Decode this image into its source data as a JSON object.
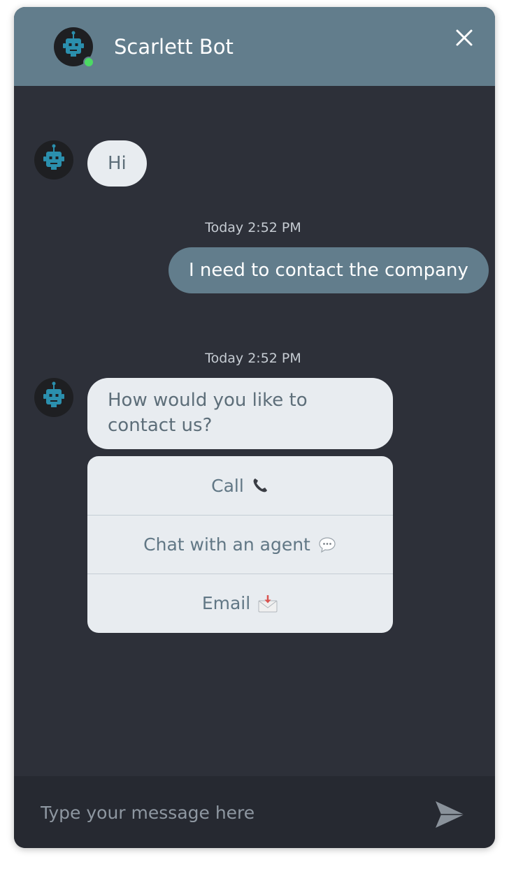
{
  "header": {
    "bot_name": "Scarlett Bot",
    "status": "online",
    "status_color": "#4cd964",
    "close_icon": "close-icon"
  },
  "messages": [
    {
      "from": "bot",
      "text": "Hi"
    },
    {
      "timestamp": "Today 2:52 PM",
      "from": "user",
      "text": "I need to contact the company"
    },
    {
      "timestamp": "Today 2:52 PM",
      "from": "bot",
      "text": "How would you like to contact us?"
    }
  ],
  "options": [
    {
      "label": "Call",
      "icon": "telephone-icon"
    },
    {
      "label": "Chat with an agent",
      "icon": "speech-bubble-icon"
    },
    {
      "label": "Email",
      "icon": "envelope-icon"
    }
  ],
  "composer": {
    "placeholder": "Type your message here",
    "value": "",
    "send_icon": "send-icon"
  },
  "colors": {
    "header_bg": "#627d8c",
    "chat_bg": "#2d3039",
    "bot_bubble": "#e8ecf0",
    "user_bubble": "#627d8c",
    "composer_bg": "#262931"
  }
}
